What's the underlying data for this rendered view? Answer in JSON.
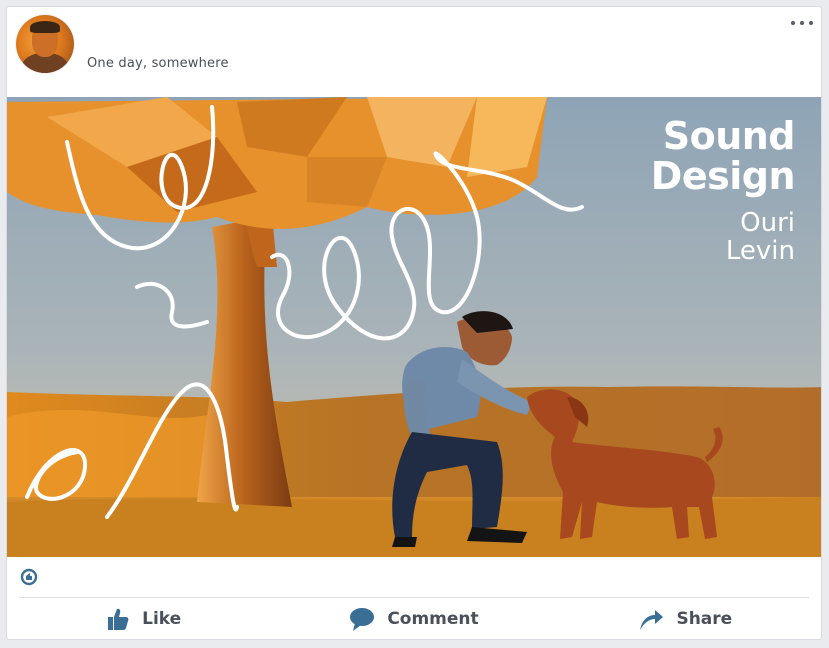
{
  "post": {
    "caption": "One day, somewhere",
    "media": {
      "title": "Sound\nDesign",
      "author": "Ouri\nLevin"
    }
  },
  "icons": {
    "avatar": "user-avatar",
    "more": "more-options-icon",
    "reaction": "like-reaction-icon",
    "like": "thumbs-up-icon",
    "comment": "speech-bubble-icon",
    "share": "share-arrow-icon"
  },
  "actions": {
    "like_label": "Like",
    "comment_label": "Comment",
    "share_label": "Share"
  },
  "colors": {
    "accent": "#3b6e94",
    "sky_top": "#8fa6b8",
    "sky_bottom": "#c9c3b0",
    "foliage": "#e8912a",
    "ground": "#c87a1c"
  }
}
